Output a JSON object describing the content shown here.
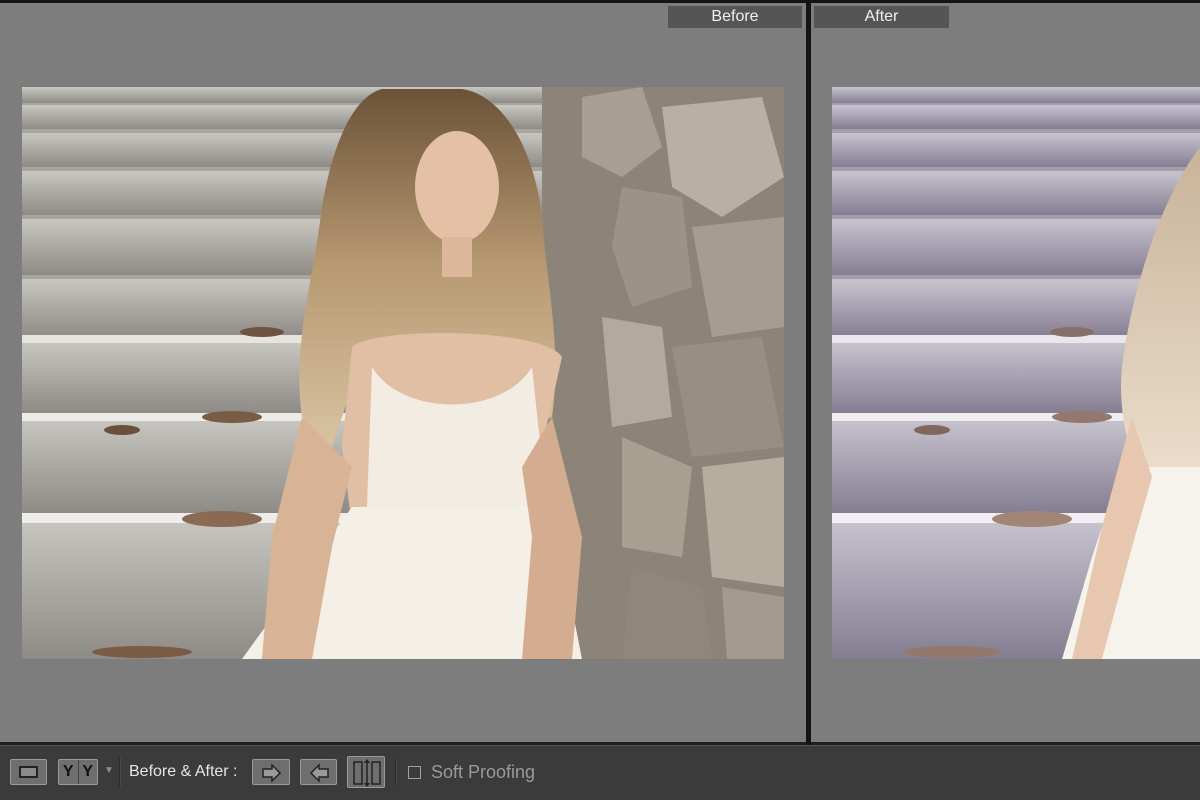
{
  "panes": {
    "before_label": "Before",
    "after_label": "After"
  },
  "toolbar": {
    "loupe_icon": "loupe-view-icon",
    "yy_left": "Y",
    "yy_right": "Y",
    "before_after_label": "Before & After :",
    "swap_icons": [
      "copy-before-to-after-icon",
      "copy-after-to-before-icon",
      "swap-before-after-icon"
    ],
    "soft_proofing_label": "Soft Proofing",
    "soft_proofing_checked": false
  },
  "colors": {
    "pane_bg": "#7d7d7d",
    "toolbar_bg": "#3b3b3b",
    "label_bg": "#555555"
  }
}
